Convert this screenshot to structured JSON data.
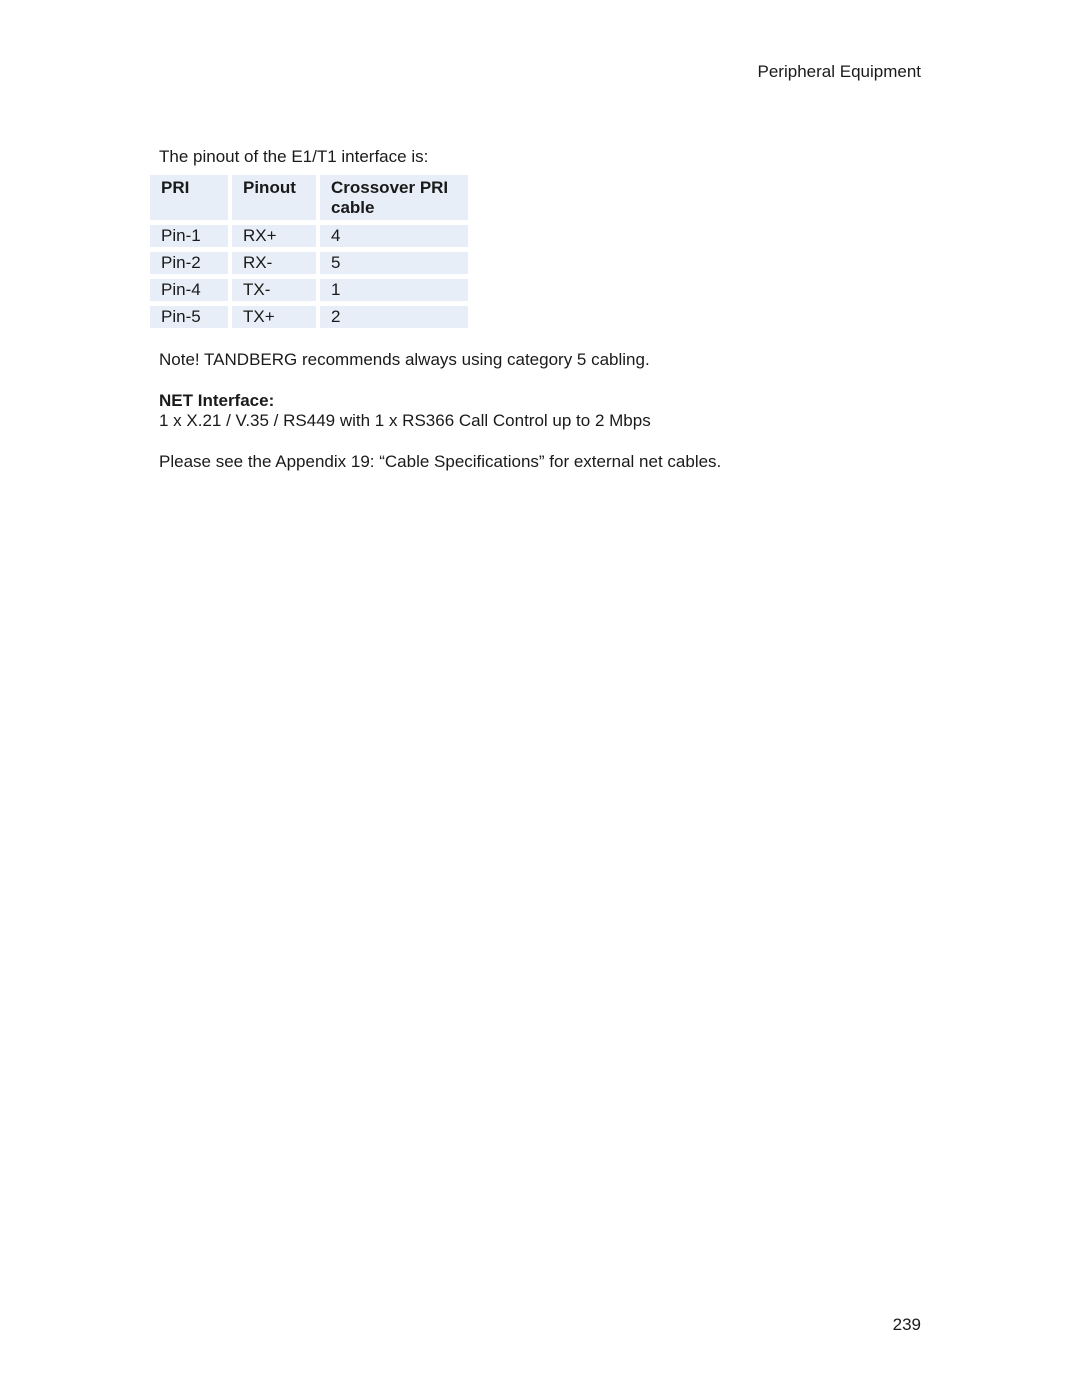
{
  "header": {
    "section_title": "Peripheral Equipment"
  },
  "content": {
    "intro": "The pinout of the E1/T1 interface is:",
    "table": {
      "columns": [
        "PRI",
        "Pinout",
        "Crossover PRI cable"
      ],
      "rows": [
        [
          "Pin-1",
          "RX+",
          "4"
        ],
        [
          "Pin-2",
          "RX-",
          "5"
        ],
        [
          "Pin-4",
          "TX-",
          "1"
        ],
        [
          "Pin-5",
          "TX+",
          "2"
        ]
      ]
    },
    "note": "Note! TANDBERG recommends always using category 5 cabling.",
    "net_heading": "NET Interface:",
    "net_spec": "1 x X.21 / V.35 / RS449 with 1 x RS366 Call Control up to 2 Mbps",
    "appendix_ref": "Please see the Appendix 19: “Cable Specifications” for external net cables."
  },
  "footer": {
    "page_number": "239"
  },
  "colors": {
    "table_cell_bg": "#e8eef7"
  }
}
